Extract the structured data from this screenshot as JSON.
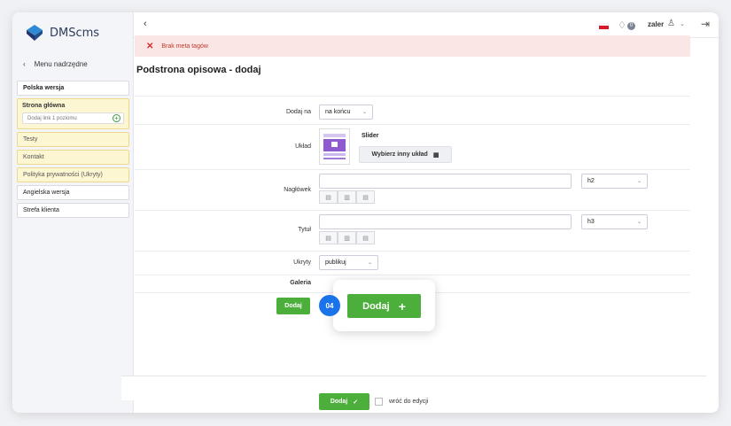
{
  "app": {
    "name": "DMScms"
  },
  "sidebar": {
    "back_label": "Menu nadrzędne",
    "items": [
      {
        "label": "Polska wersja"
      },
      {
        "label": "Strona główna",
        "sub_placeholder": "Dodaj link 1 poziomu"
      },
      {
        "label": "Testy"
      },
      {
        "label": "Kontakt"
      },
      {
        "label": "Polityka prywatności (Ukryty)"
      },
      {
        "label": "Angielska wersja"
      },
      {
        "label": "Strefa klienta"
      }
    ]
  },
  "topbar": {
    "user": "zaler",
    "notifications": "0"
  },
  "alert": {
    "text": "Brak meta tagów"
  },
  "page": {
    "title": "Podstrona opisowa - dodaj"
  },
  "form": {
    "add_at": {
      "label": "Dodaj na",
      "value": "na końcu"
    },
    "layout": {
      "label": "Układ",
      "name": "Slider",
      "choose_label": "Wybierz inny układ"
    },
    "heading": {
      "label": "Nagłówek",
      "level": "h2"
    },
    "title": {
      "label": "Tytuł",
      "level": "h3"
    },
    "hidden": {
      "label": "Ukryty",
      "value": "publikuj"
    },
    "gallery": {
      "label": "Galeria",
      "add_label": "Dodaj"
    }
  },
  "callout": {
    "step": "04",
    "button_label": "Dodaj"
  },
  "footer": {
    "submit_label": "Dodaj",
    "return_label": "wróć do edycji"
  },
  "colors": {
    "accent": "#4caf3c",
    "step": "#1a73e8",
    "alert_bg": "#fbe6e6"
  }
}
